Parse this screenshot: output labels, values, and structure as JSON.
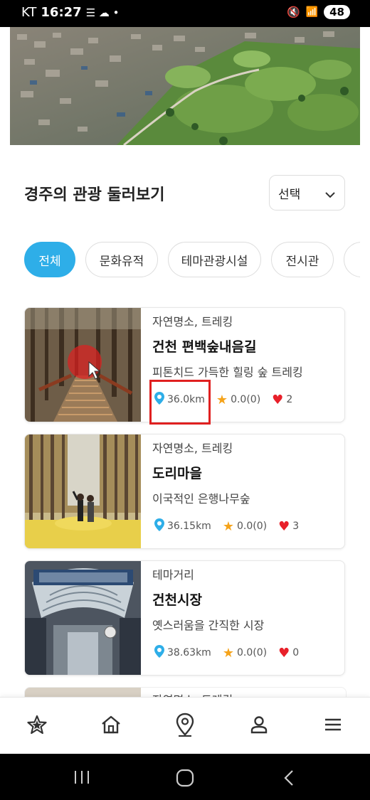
{
  "status_bar": {
    "carrier": "KT",
    "time": "16:27",
    "battery": "48"
  },
  "section": {
    "title": "경주의 관광 둘러보기",
    "select_value": "선택"
  },
  "tabs": [
    {
      "label": "전체",
      "active": true
    },
    {
      "label": "문화유적",
      "active": false
    },
    {
      "label": "테마관광시설",
      "active": false
    },
    {
      "label": "전시관",
      "active": false
    }
  ],
  "cards": [
    {
      "category": "자연명소, 트레킹",
      "title": "건천 편백숲내음길",
      "description": "피톤치드 가득한 힐링 숲 트레킹",
      "distance": "36.0km",
      "rating": "0.0(0)",
      "likes": "2"
    },
    {
      "category": "자연명소, 트레킹",
      "title": "도리마을",
      "description": "이국적인 은행나무숲",
      "distance": "36.15km",
      "rating": "0.0(0)",
      "likes": "3"
    },
    {
      "category": "테마거리",
      "title": "건천시장",
      "description": "옛스러움을 간직한 시장",
      "distance": "38.63km",
      "rating": "0.0(0)",
      "likes": "0"
    }
  ],
  "partial_card": {
    "category": "자연명소, 트레킹"
  },
  "colors": {
    "accent": "#2eaee8",
    "star": "#f5a31a",
    "heart": "#e8202a",
    "pin": "#2eaee8",
    "highlight": "#e02020"
  },
  "bottom_nav": [
    "star-icon",
    "home-icon",
    "location-pin-icon",
    "user-icon",
    "menu-icon"
  ]
}
